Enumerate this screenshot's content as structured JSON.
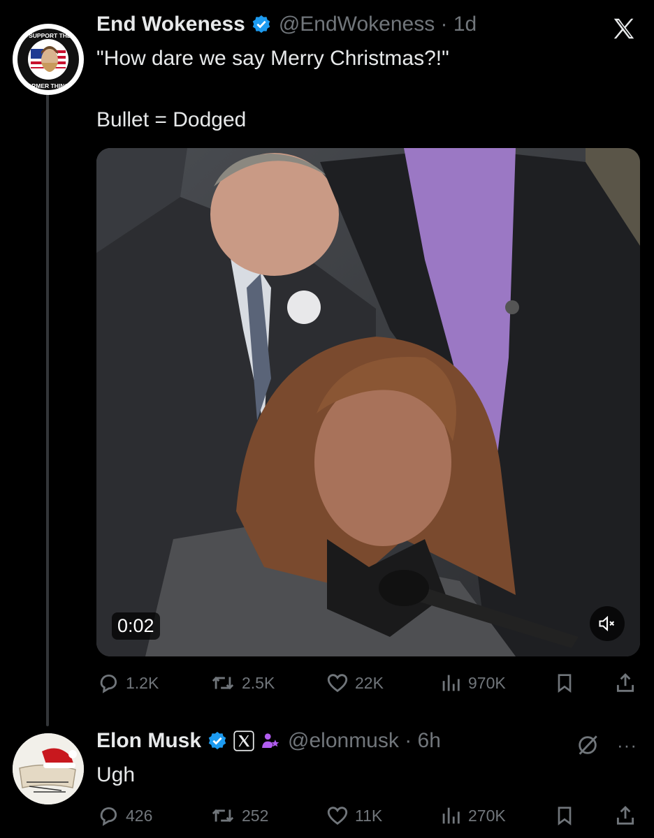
{
  "post": {
    "display_name": "End Wokeness",
    "handle_time": "@EndWokeness · 1d",
    "text": "\"How dare we say Merry Christmas?!\"\n\nBullet = Dodged",
    "avatar_badge_top": "I SUPPORT THE",
    "avatar_badge_bottom": "FORMER THINGS",
    "video": {
      "timestamp": "0:02"
    },
    "actions": {
      "replies": "1.2K",
      "reposts": "2.5K",
      "likes": "22K",
      "views": "970K"
    }
  },
  "reply": {
    "display_name": "Elon Musk",
    "handle_time": "@elonmusk · 6h",
    "text": "Ugh",
    "more_label": "···",
    "actions": {
      "replies": "426",
      "reposts": "252",
      "likes": "11K",
      "views": "270K"
    }
  },
  "colors": {
    "background": "#000000",
    "verified": "#1d9bf0",
    "muted": "#71767b",
    "text": "#e7e9ea",
    "purple_badge": "#b25df0"
  }
}
